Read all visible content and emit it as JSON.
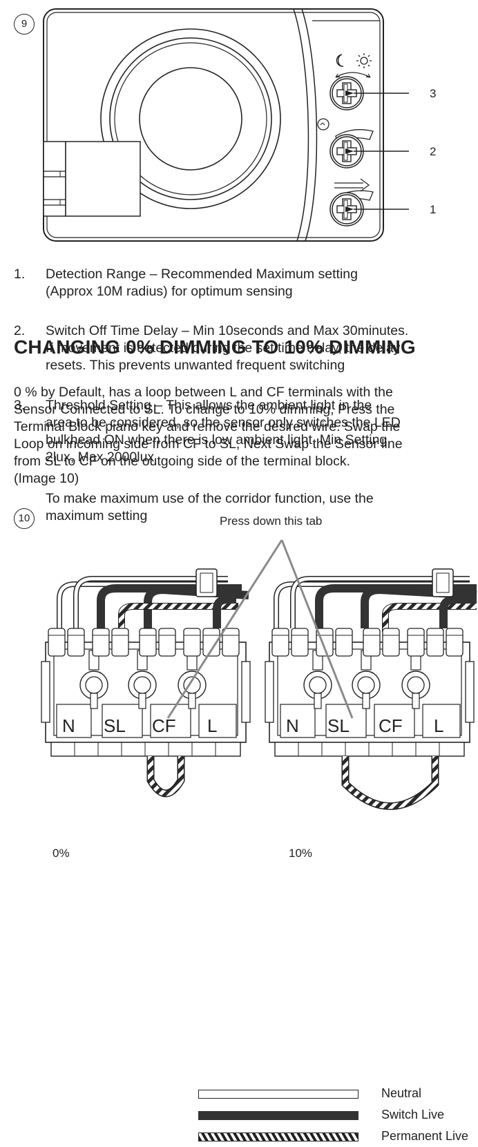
{
  "figure9": {
    "number": "9",
    "callouts": [
      "3",
      "2",
      "1"
    ]
  },
  "instructions": [
    {
      "num": "1.",
      "lines": [
        "Detection Range – Recommended Maximum setting",
        "(Approx  10M radius) for optimum sensing"
      ]
    },
    {
      "num": "2.",
      "lines": [
        "Switch Off Time Delay – Min 10seconds and Max 30minutes.",
        "If movement is detected during the set time delay, the delay",
        "resets. This prevents unwanted frequent switching"
      ]
    },
    {
      "num": "3.",
      "lines": [
        "Threshold Setting – This allows the ambient light in the",
        "area to be considered, so the sensor only switches the LED",
        "bulkhead ON when there is low ambient light. Min Setting",
        "2lux, Max 2000lux"
      ]
    }
  ],
  "corridor_note": [
    "To make maximum use of the corridor function, use the",
    "maximum setting"
  ],
  "heading": "CHANGING 0% DIMMING TO 10% DIMMING",
  "paragraph": [
    "0 % by Default, has a loop between L and CF terminals with the",
    "Sensor Connected to SL. To change to 10% dimming, Press the",
    "Terminal Block piano key and remove the desired wire. Swap the",
    "Loop on incoming side from CF to SL, Next Swap the Sensor line",
    "from SL to CF on the outgoing side of the terminal block.",
    "(Image 10)"
  ],
  "figure10": {
    "number": "10",
    "tab_label": "Press down this tab",
    "terminals": [
      "N",
      "SL",
      "CF",
      "L"
    ],
    "caption_left": "0%",
    "caption_right": "10%"
  },
  "legend": [
    {
      "label": "Neutral",
      "style": "white"
    },
    {
      "label": "Switch Live",
      "style": "black"
    },
    {
      "label": "Permanent Live",
      "style": "hatched"
    }
  ],
  "colors": {
    "ink": "#222222",
    "grey": "#8a8a8a",
    "wire_dark": "#3a3a3a"
  }
}
